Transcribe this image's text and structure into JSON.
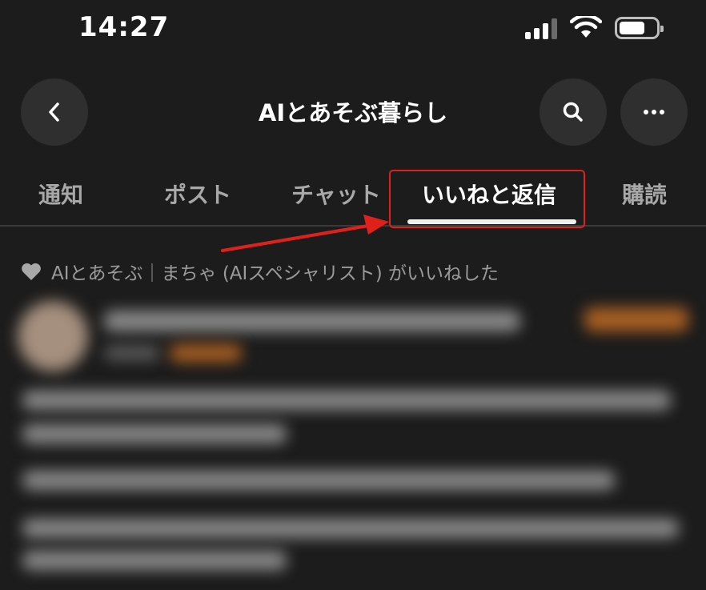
{
  "status_bar": {
    "time": "14:27",
    "battery_level": 0.7
  },
  "header": {
    "title": "AIとあそぶ暮らし",
    "back_icon": "chevron-left-icon",
    "search_icon": "search-icon",
    "more_icon": "ellipsis-icon"
  },
  "tabs": [
    {
      "label": "通知",
      "active": false
    },
    {
      "label": "ポスト",
      "active": false
    },
    {
      "label": "チャット",
      "active": false
    },
    {
      "label": "いいねと返信",
      "active": true
    },
    {
      "label": "購読",
      "active": false
    }
  ],
  "annotation": {
    "highlight_color": "#e0211b"
  },
  "activity": {
    "liked_by_text": "AIとあそぶ｜まちゃ (AIスペシャリスト) がいいねした",
    "icon": "heart-icon"
  },
  "colors": {
    "background": "#1c1c1c",
    "button_bg": "#2f2f2f",
    "inactive_tab": "#a8a8a8",
    "active_tab": "#ffffff"
  }
}
